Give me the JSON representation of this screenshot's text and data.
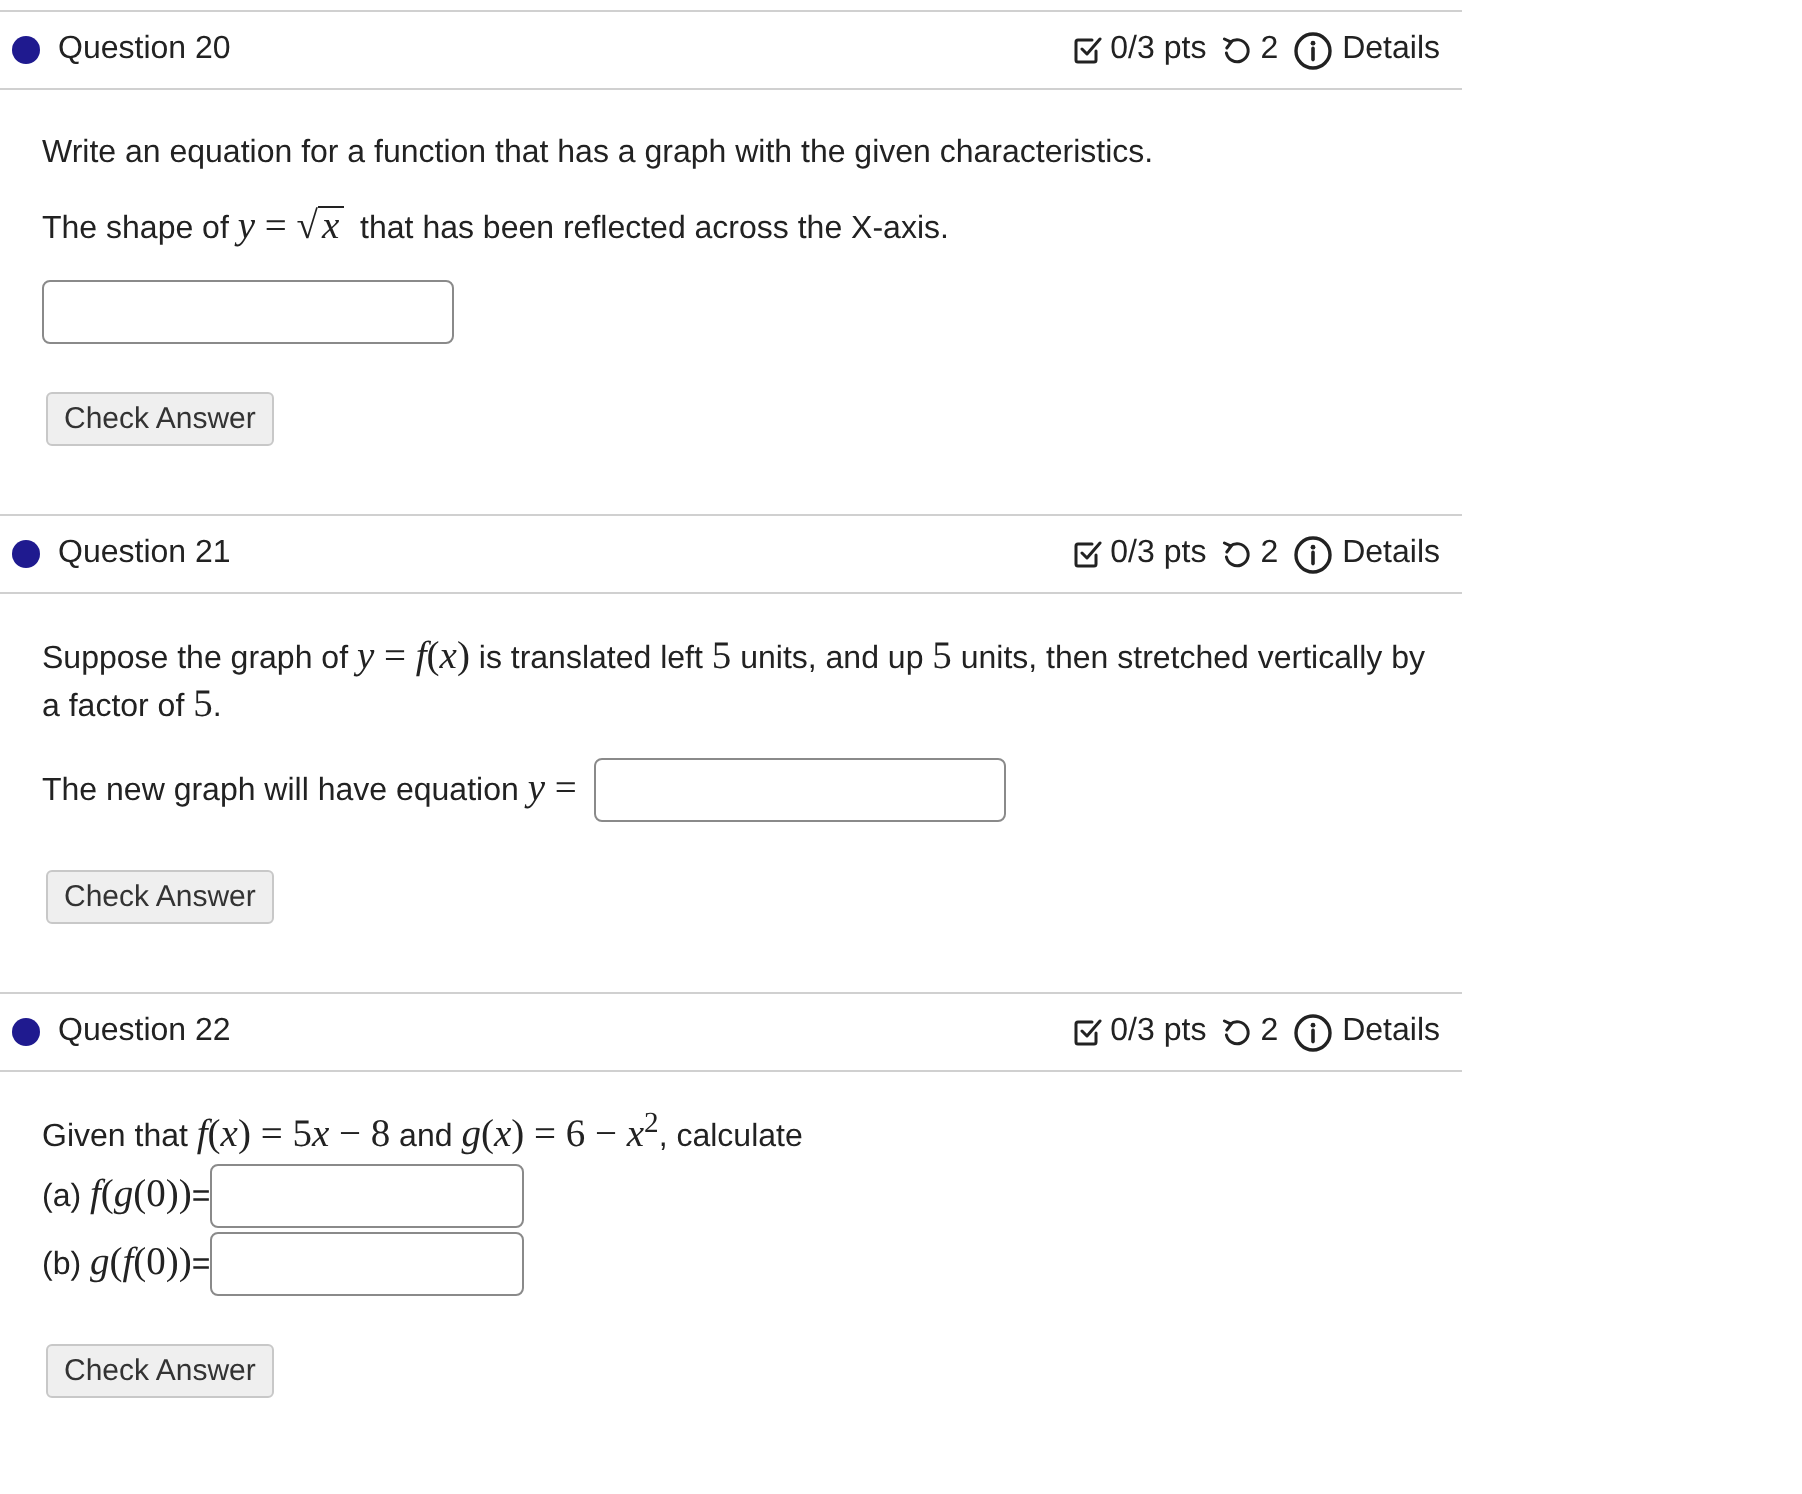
{
  "questions": [
    {
      "title": "Question 20",
      "points": "0/3 pts",
      "attempts": "2",
      "details": "Details",
      "button": "Check Answer",
      "body": [
        {
          "kind": "paragraph",
          "segments": [
            {
              "kind": "text",
              "text": "Write an equation for a function that has a graph with the given characteristics."
            }
          ]
        },
        {
          "kind": "paragraph",
          "segments": [
            {
              "kind": "text",
              "text": "The shape of "
            },
            {
              "kind": "math",
              "text": "*y* = √"
            },
            {
              "kind": "radicand",
              "text": "*x*"
            },
            {
              "kind": "text",
              "text": " that has been reflected across the X-axis."
            }
          ]
        },
        {
          "kind": "paragraph",
          "segments": [
            {
              "kind": "field"
            }
          ]
        }
      ]
    },
    {
      "title": "Question 21",
      "points": "0/3 pts",
      "attempts": "2",
      "details": "Details",
      "button": "Check Answer",
      "body": [
        {
          "kind": "paragraph",
          "segments": [
            {
              "kind": "text",
              "text": "Suppose the graph of "
            },
            {
              "kind": "math",
              "text": "*y* = *f*(*x*)"
            },
            {
              "kind": "text",
              "text": " is translated left "
            },
            {
              "kind": "math",
              "text": "5"
            },
            {
              "kind": "text",
              "text": " units, and up "
            },
            {
              "kind": "math",
              "text": "5"
            },
            {
              "kind": "text",
              "text": " units, then stretched vertically by a factor of "
            },
            {
              "kind": "math",
              "text": "5"
            },
            {
              "kind": "text",
              "text": "."
            }
          ]
        },
        {
          "kind": "paragraph",
          "segments": [
            {
              "kind": "text",
              "text": "The new graph will have equation "
            },
            {
              "kind": "math",
              "text": "*y* ="
            },
            {
              "kind": "field"
            }
          ]
        }
      ]
    },
    {
      "title": "Question 22",
      "points": "0/3 pts",
      "attempts": "2",
      "details": "Details",
      "button": "Check Answer",
      "body": [
        {
          "kind": "line",
          "segments": [
            {
              "kind": "text",
              "text": "Given that "
            },
            {
              "kind": "math",
              "text": "*f*(*x*) = 5"
            },
            {
              "kind": "math",
              "text": "*x* − 8"
            },
            {
              "kind": "text",
              "text": " and "
            },
            {
              "kind": "math",
              "text": "*g*(*x*) = 6 − *x*$^{2}$"
            },
            {
              "kind": "text",
              "text": ", calculate"
            }
          ]
        },
        {
          "kind": "line",
          "segments": [
            {
              "kind": "text",
              "text": "(a) "
            },
            {
              "kind": "math",
              "text": "*f*(*g*(0))"
            },
            {
              "kind": "text",
              "text": "="
            },
            {
              "kind": "field"
            }
          ]
        },
        {
          "kind": "line",
          "segments": [
            {
              "kind": "text",
              "text": "(b) "
            },
            {
              "kind": "math",
              "text": "*g*(*f*(0))"
            },
            {
              "kind": "text",
              "text": "="
            },
            {
              "kind": "field"
            }
          ]
        }
      ]
    }
  ]
}
